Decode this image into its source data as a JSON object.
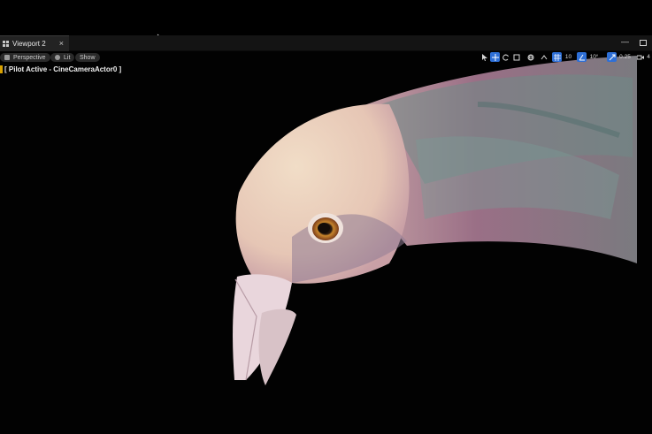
{
  "tab": {
    "title": "Viewport 2",
    "close": "×"
  },
  "window": {
    "minimize": "—",
    "restore": ""
  },
  "viewport_toolbar": {
    "perspective": "Perspective",
    "lit": "Lit",
    "show": "Show",
    "grid_snap_value": "10",
    "rotation_snap_value": "10°",
    "scale_snap_value": "0.25",
    "camera_speed_value": "4"
  },
  "pilot_label": "[ Pilot Active - CineCameraActor0 ]",
  "colors": {
    "accent": "#2e6fd6",
    "pilot_marker": "#d9a200"
  }
}
